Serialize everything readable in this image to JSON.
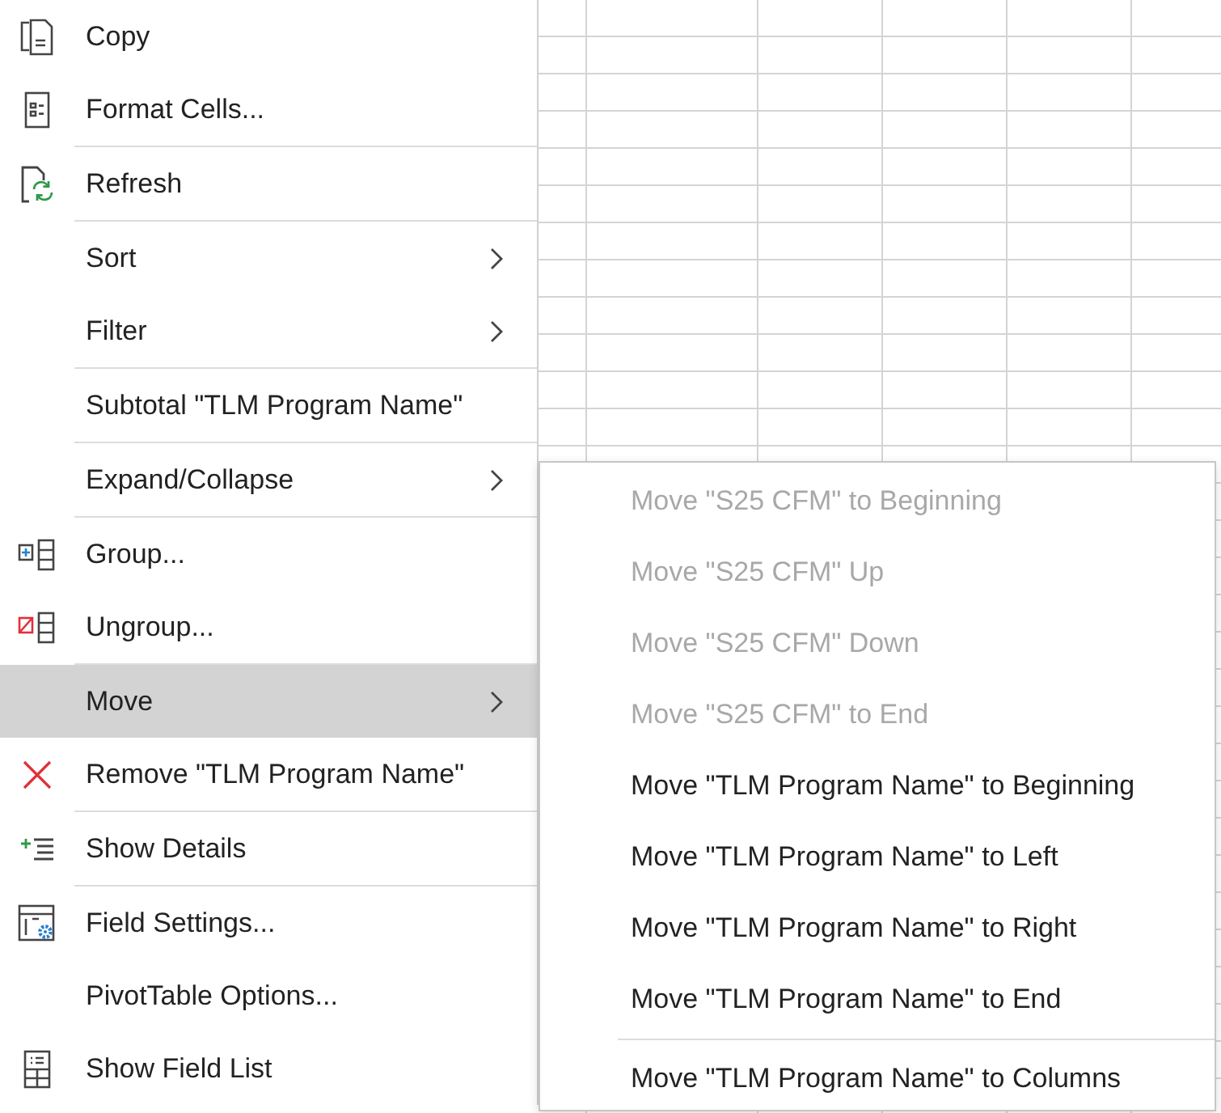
{
  "context_menu": {
    "items": [
      {
        "kind": "item",
        "label": "Copy",
        "has_submenu": false,
        "selected": false
      },
      {
        "kind": "item",
        "label": "Format Cells...",
        "has_submenu": false,
        "selected": false
      },
      {
        "kind": "separator"
      },
      {
        "kind": "item",
        "label": "Refresh",
        "has_submenu": false,
        "selected": false
      },
      {
        "kind": "separator"
      },
      {
        "kind": "item",
        "label": "Sort",
        "has_submenu": true,
        "selected": false
      },
      {
        "kind": "item",
        "label": "Filter",
        "has_submenu": true,
        "selected": false
      },
      {
        "kind": "separator"
      },
      {
        "kind": "item",
        "label": "Subtotal \"TLM Program Name\"",
        "has_submenu": false,
        "selected": false
      },
      {
        "kind": "separator"
      },
      {
        "kind": "item",
        "label": "Expand/Collapse",
        "has_submenu": true,
        "selected": false
      },
      {
        "kind": "separator"
      },
      {
        "kind": "item",
        "label": "Group...",
        "has_submenu": false,
        "selected": false
      },
      {
        "kind": "item",
        "label": "Ungroup...",
        "has_submenu": false,
        "selected": false
      },
      {
        "kind": "separator"
      },
      {
        "kind": "item",
        "label": "Move",
        "has_submenu": true,
        "selected": true
      },
      {
        "kind": "item",
        "label": "Remove \"TLM Program Name\"",
        "has_submenu": false,
        "selected": false
      },
      {
        "kind": "separator"
      },
      {
        "kind": "item",
        "label": "Show Details",
        "has_submenu": false,
        "selected": false
      },
      {
        "kind": "separator"
      },
      {
        "kind": "item",
        "label": "Field Settings...",
        "has_submenu": false,
        "selected": false
      },
      {
        "kind": "item",
        "label": "PivotTable Options...",
        "has_submenu": false,
        "selected": false
      },
      {
        "kind": "item",
        "label": "Show Field List",
        "has_submenu": false,
        "selected": false
      }
    ]
  },
  "move_submenu": {
    "items": [
      {
        "kind": "item",
        "label": "Move \"S25 CFM\" to Beginning",
        "disabled": true
      },
      {
        "kind": "item",
        "label": "Move \"S25 CFM\" Up",
        "disabled": true
      },
      {
        "kind": "item",
        "label": "Move \"S25 CFM\" Down",
        "disabled": true
      },
      {
        "kind": "item",
        "label": "Move \"S25 CFM\" to End",
        "disabled": true
      },
      {
        "kind": "item",
        "label": "Move \"TLM Program Name\" to Beginning",
        "disabled": false
      },
      {
        "kind": "item",
        "label": "Move \"TLM Program Name\" to Left",
        "disabled": false
      },
      {
        "kind": "item",
        "label": "Move \"TLM Program Name\" to Right",
        "disabled": false
      },
      {
        "kind": "item",
        "label": "Move \"TLM Program Name\" to End",
        "disabled": false
      },
      {
        "kind": "separator"
      },
      {
        "kind": "item",
        "label": "Move \"TLM Program Name\" to Columns",
        "disabled": false
      }
    ]
  }
}
